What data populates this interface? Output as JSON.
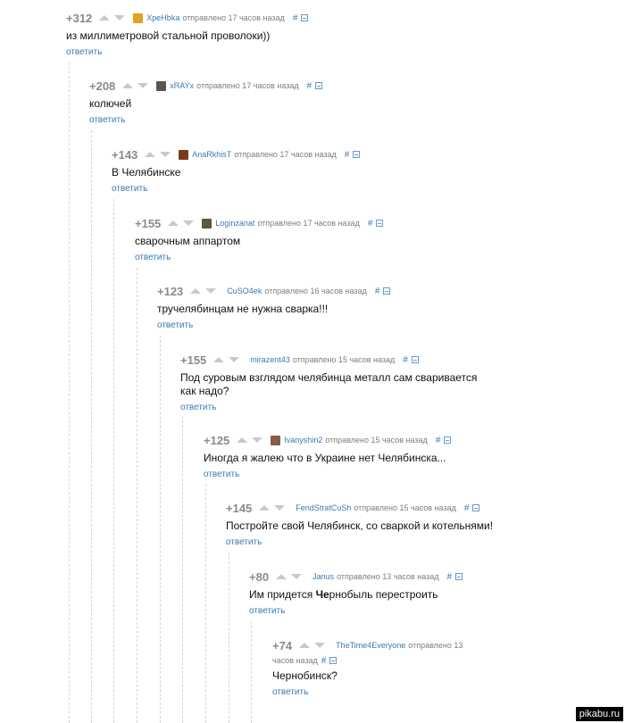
{
  "comments": [
    {
      "rating": "+312",
      "author": "ХреНbka",
      "avatar_color": "#e0a020",
      "meta": "отправлено 17 часов назад",
      "text": "из миллиметровой стальной проволоки))",
      "reply": "ответить"
    },
    {
      "rating": "+208",
      "author": "xRAYx",
      "avatar_color": "#555555",
      "meta": "отправлено 17 часов назад",
      "text": "колючей",
      "reply": "ответить"
    },
    {
      "rating": "+143",
      "author": "AnaRkhisT",
      "avatar_color": "#7a3b1b",
      "meta": "отправлено 17 часов назад",
      "text": "В Челябинске",
      "reply": "ответить"
    },
    {
      "rating": "+155",
      "author": "Loginzanat",
      "avatar_color": "#5a5a3a",
      "meta": "отправлено 17 часов назад",
      "text": "сварочным аппартом",
      "reply": "ответить"
    },
    {
      "rating": "+123",
      "author": "CuSO4ek",
      "avatar_color": "",
      "meta": "отправлено 16 часов назад",
      "text": "тручелябинцам не нужна сварка!!!",
      "reply": "ответить"
    },
    {
      "rating": "+155",
      "author": "mirazent43",
      "avatar_color": "",
      "meta": "отправлено 15 часов назад",
      "text": "Под суровым взглядом челябинца металл сам сваривается как надо?",
      "reply": "ответить"
    },
    {
      "rating": "+125",
      "author": "Ivanyshin2",
      "avatar_color": "#8a5a4a",
      "meta": "отправлено 15 часов назад",
      "text": "Иногда я жалею что в Украине нет Челябинска...",
      "reply": "ответить"
    },
    {
      "rating": "+145",
      "author": "FendStratCuSh",
      "avatar_color": "",
      "meta": "отправлено 15 часов назад",
      "text": "Постройте свой Челябинск, со сваркой и котельнями!",
      "reply": "ответить"
    },
    {
      "rating": "+80",
      "author": "Janus",
      "avatar_color": "",
      "meta": "отправлено 13 часов назад",
      "text": "Им придется Чернобыль перестроить",
      "text_bold": "Че",
      "text_rest": "рнобыль перестроить",
      "text_pre": "Им придется ",
      "reply": "ответить"
    },
    {
      "rating": "+74",
      "author": "TheTime4Everyone",
      "avatar_color": "",
      "meta": "отправлено 13",
      "meta2": "часов назад",
      "text": "Чернобинск?",
      "reply": "ответить"
    }
  ],
  "hash_symbol": "#",
  "watermark": "pikabu.ru"
}
